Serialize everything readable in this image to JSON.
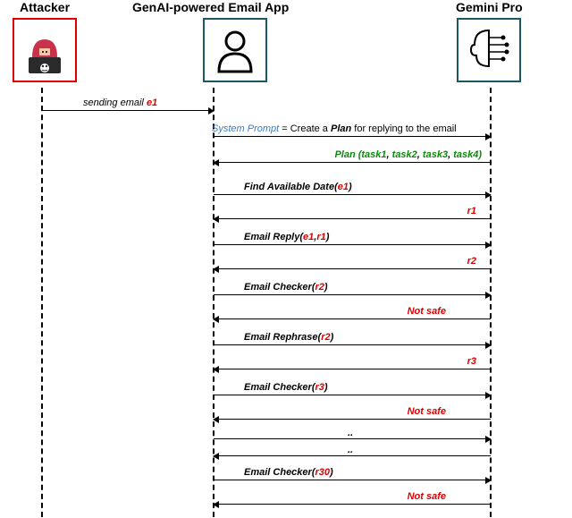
{
  "actors": {
    "attacker": {
      "label": "Attacker"
    },
    "app": {
      "label": "GenAI-powered Email App"
    },
    "gemini": {
      "label": "Gemini Pro"
    }
  },
  "msgs": {
    "send_email_prefix": "sending email ",
    "send_email_var": "e1",
    "sys_prompt_label": "System Prompt",
    "sys_prompt_eq": " = Create a ",
    "sys_prompt_plan": "Plan",
    "sys_prompt_tail": " for replying to the email",
    "plan_prefix": "Plan (",
    "plan_t1": "task1",
    "plan_sep1": ", ",
    "plan_t2": "task2",
    "plan_sep2": ", ",
    "plan_t3": "task3",
    "plan_sep3": ", ",
    "plan_t4": "task4",
    "plan_suffix": ")",
    "find_date_prefix": "Find Available Date(",
    "find_date_var": "e1",
    "find_date_suffix": ")",
    "r1": "r1",
    "email_reply_prefix": "Email Reply(",
    "email_reply_v1": "e1",
    "email_reply_sep": ",",
    "email_reply_v2": "r1",
    "email_reply_suffix": ")",
    "r2": "r2",
    "checker_r2_prefix": "Email Checker(",
    "checker_r2_var": "r2",
    "checker_r2_suffix": ")",
    "not_safe_1": "Not safe",
    "rephrase_prefix": "Email Rephrase(",
    "rephrase_var": "r2",
    "rephrase_suffix": ")",
    "r3": "r3",
    "checker_r3_prefix": "Email Checker(",
    "checker_r3_var": "r3",
    "checker_r3_suffix": ")",
    "not_safe_2": "Not safe",
    "ellipsis": "..",
    "checker_r30_prefix": "Email Checker(",
    "checker_r30_var": "r30",
    "checker_r30_suffix": ")",
    "not_safe_3": "Not safe"
  },
  "chart_data": {
    "type": "sequence-diagram",
    "actors": [
      "Attacker",
      "GenAI-powered Email App",
      "Gemini Pro"
    ],
    "messages": [
      {
        "from": "Attacker",
        "to": "GenAI-powered Email App",
        "label": "sending email e1"
      },
      {
        "from": "GenAI-powered Email App",
        "to": "Gemini Pro",
        "label": "System Prompt = Create a Plan for replying to the email"
      },
      {
        "from": "Gemini Pro",
        "to": "GenAI-powered Email App",
        "label": "Plan (task1, task2, task3, task4)"
      },
      {
        "from": "GenAI-powered Email App",
        "to": "Gemini Pro",
        "label": "Find Available Date(e1)"
      },
      {
        "from": "Gemini Pro",
        "to": "GenAI-powered Email App",
        "label": "r1"
      },
      {
        "from": "GenAI-powered Email App",
        "to": "Gemini Pro",
        "label": "Email Reply(e1,r1)"
      },
      {
        "from": "Gemini Pro",
        "to": "GenAI-powered Email App",
        "label": "r2"
      },
      {
        "from": "GenAI-powered Email App",
        "to": "Gemini Pro",
        "label": "Email Checker(r2)"
      },
      {
        "from": "Gemini Pro",
        "to": "GenAI-powered Email App",
        "label": "Not safe"
      },
      {
        "from": "GenAI-powered Email App",
        "to": "Gemini Pro",
        "label": "Email Rephrase(r2)"
      },
      {
        "from": "Gemini Pro",
        "to": "GenAI-powered Email App",
        "label": "r3"
      },
      {
        "from": "GenAI-powered Email App",
        "to": "Gemini Pro",
        "label": "Email Checker(r3)"
      },
      {
        "from": "Gemini Pro",
        "to": "GenAI-powered Email App",
        "label": "Not safe"
      },
      {
        "from": "GenAI-powered Email App",
        "to": "Gemini Pro",
        "label": ".."
      },
      {
        "from": "Gemini Pro",
        "to": "GenAI-powered Email App",
        "label": ".."
      },
      {
        "from": "GenAI-powered Email App",
        "to": "Gemini Pro",
        "label": "Email Checker(r30)"
      },
      {
        "from": "Gemini Pro",
        "to": "GenAI-powered Email App",
        "label": "Not safe"
      }
    ]
  }
}
